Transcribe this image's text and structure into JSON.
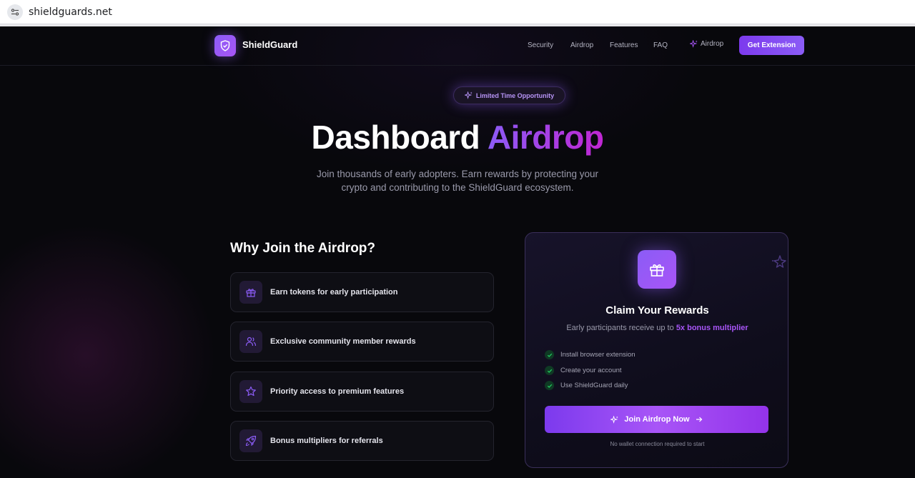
{
  "browser": {
    "url": "shieldguards.net"
  },
  "nav": {
    "brand": "ShieldGuard",
    "links": [
      "Security",
      "Airdrop",
      "Features",
      "FAQ"
    ],
    "airdrop_link": "Airdrop",
    "cta": "Get Extension"
  },
  "hero": {
    "badge": "Limited Time Opportunity",
    "title_main": "Dashboard",
    "title_accent": "Airdrop",
    "subtitle": "Join thousands of early adopters. Earn rewards by protecting your crypto and contributing to the ShieldGuard ecosystem."
  },
  "why": {
    "title": "Why Join the Airdrop?",
    "features": [
      {
        "label": "Earn tokens for early participation",
        "icon": "gift-icon"
      },
      {
        "label": "Exclusive community member rewards",
        "icon": "users-icon"
      },
      {
        "label": "Priority access to premium features",
        "icon": "star-icon"
      },
      {
        "label": "Bonus multipliers for referrals",
        "icon": "rocket-icon"
      }
    ]
  },
  "card": {
    "title": "Claim Your Rewards",
    "subtitle_prefix": "Early participants receive up to",
    "multiplier": "5x bonus multiplier",
    "steps": [
      "Install browser extension",
      "Create your account",
      "Use ShieldGuard daily"
    ],
    "button": "Join Airdrop Now",
    "note": "No wallet connection required to start"
  },
  "colors": {
    "accent": "#8b5cf6",
    "accent_pink": "#c026d3",
    "background": "#08080c",
    "check": "#22c55e"
  }
}
